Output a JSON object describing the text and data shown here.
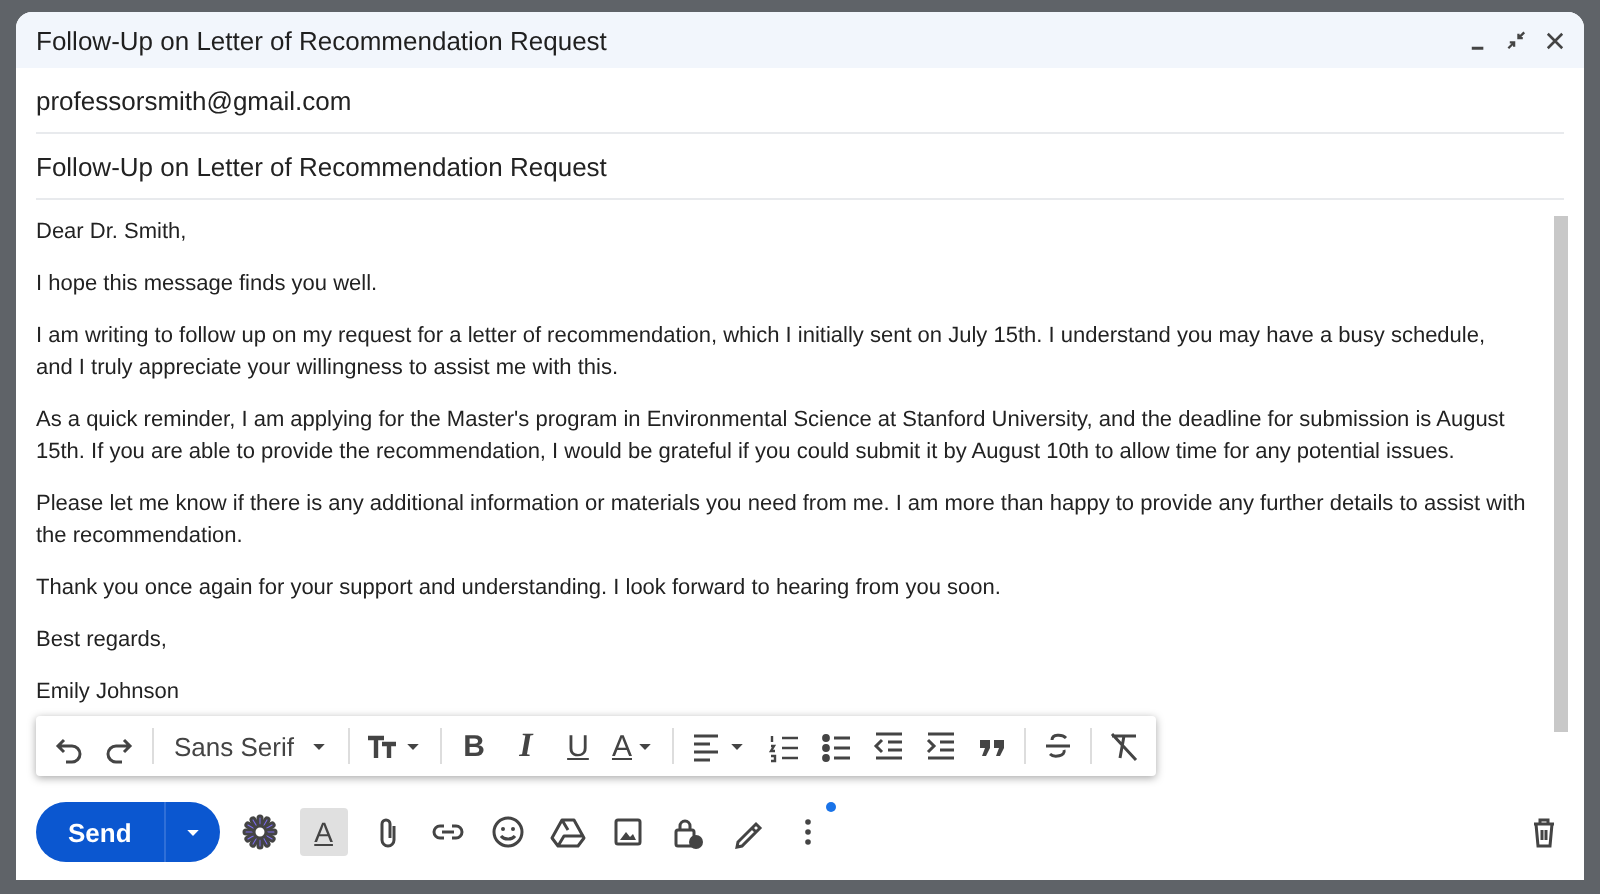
{
  "window": {
    "title": "Follow-Up on Letter of Recommendation Request"
  },
  "to": "professorsmith@gmail.com",
  "subject": "Follow-Up on Letter of Recommendation Request",
  "body": [
    "Dear Dr. Smith,",
    "I hope this message finds you well.",
    "I am writing to follow up on my request for a letter of recommendation, which I initially sent on July 15th. I understand you may have a busy schedule, and I truly appreciate your willingness to assist me with this.",
    "As a quick reminder, I am applying for the Master's program in Environmental Science at Stanford University, and the deadline for submission is August 15th. If you are able to provide the recommendation, I would be grateful if you could submit it by August 10th to allow time for any potential issues.",
    "Please let me know if there is any additional information or materials you need from me. I am more than happy to provide any further details to assist with the recommendation.",
    "Thank you once again for your support and understanding. I look forward to hearing from you soon.",
    "Best regards,",
    "Emily Johnson"
  ],
  "format_toolbar": {
    "font": "Sans Serif",
    "bold": "B",
    "italic": "I",
    "underline": "U",
    "text_color": "A"
  },
  "bottom_bar": {
    "send": "Send",
    "formatting_toggle": {
      "glyph": "A",
      "selected": true
    },
    "more_options_dot": true
  }
}
